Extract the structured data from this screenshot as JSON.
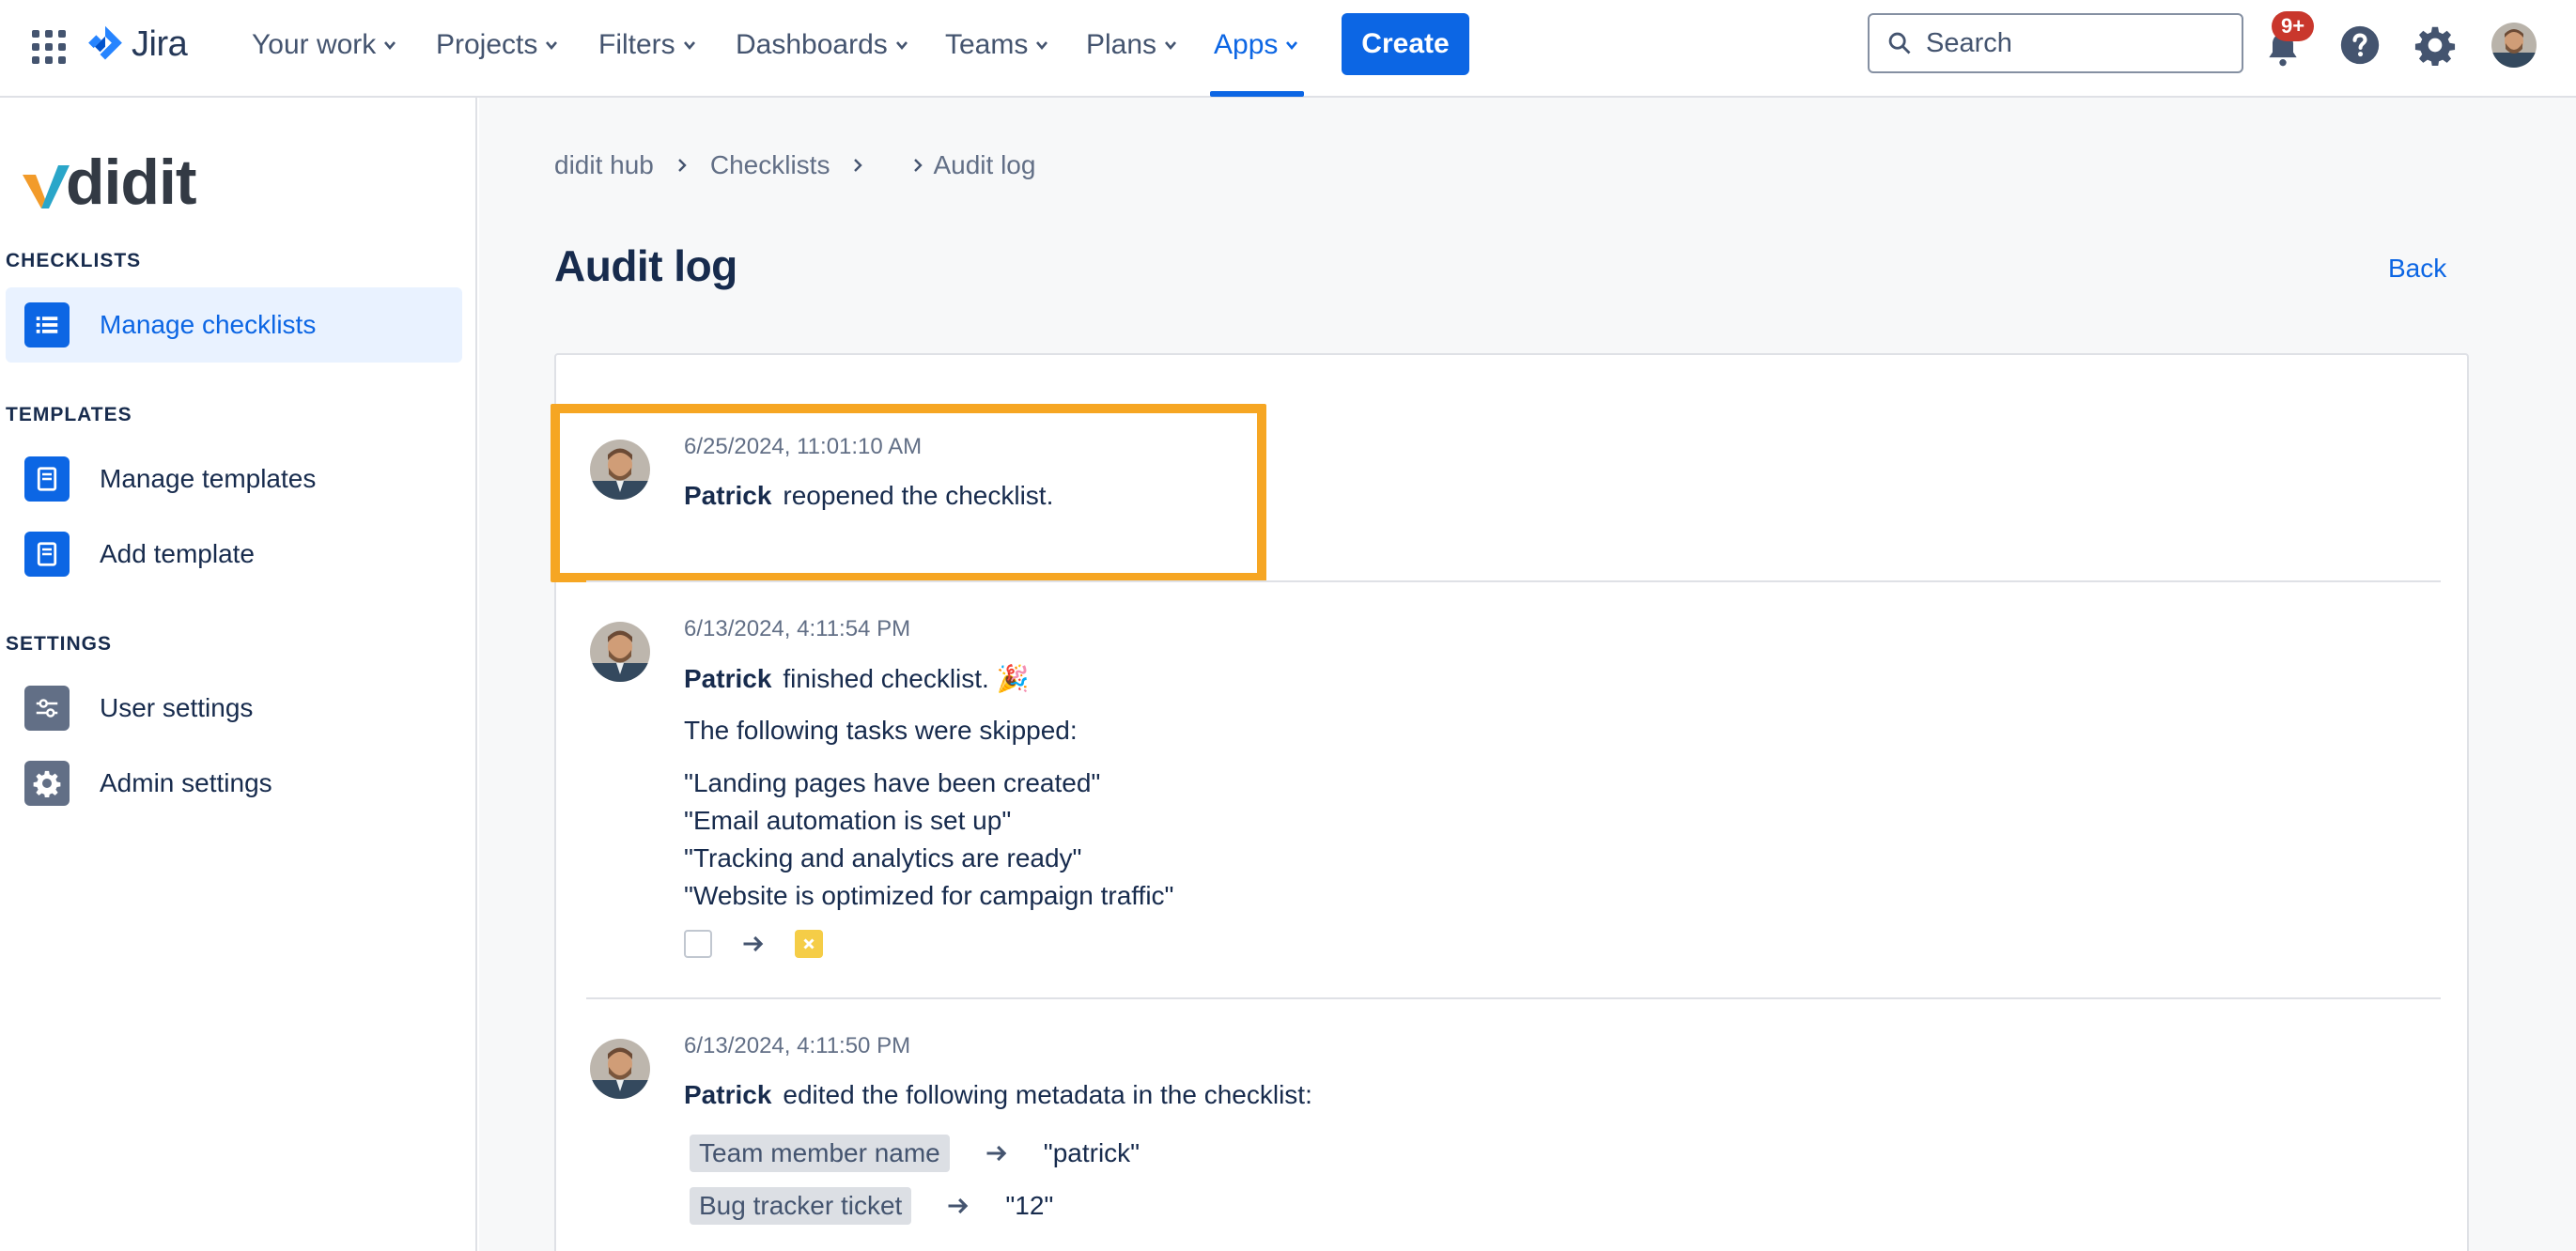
{
  "topnav": {
    "product": "Jira",
    "items": [
      {
        "label": "Your work"
      },
      {
        "label": "Projects"
      },
      {
        "label": "Filters"
      },
      {
        "label": "Dashboards"
      },
      {
        "label": "Teams"
      },
      {
        "label": "Plans"
      },
      {
        "label": "Apps",
        "active": true
      }
    ],
    "create_label": "Create",
    "search_placeholder": "Search",
    "notification_badge": "9+",
    "accent_color": "#0c66e4"
  },
  "sidebar": {
    "brand": "didit",
    "sections": [
      {
        "title": "CHECKLISTS",
        "items": [
          {
            "label": "Manage checklists",
            "icon": "list-icon",
            "active": true
          }
        ]
      },
      {
        "title": "TEMPLATES",
        "items": [
          {
            "label": "Manage templates",
            "icon": "document-icon"
          },
          {
            "label": "Add template",
            "icon": "document-icon"
          }
        ]
      },
      {
        "title": "SETTINGS",
        "items": [
          {
            "label": "User settings",
            "icon": "sliders-icon"
          },
          {
            "label": "Admin settings",
            "icon": "gear-icon"
          }
        ]
      }
    ]
  },
  "main": {
    "breadcrumb": [
      "didit hub",
      "Checklists",
      "Audit log"
    ],
    "title": "Audit log",
    "back_label": "Back",
    "highlight_color": "#f6a623",
    "entries": [
      {
        "timestamp": "6/25/2024, 11:01:10 AM",
        "user": "Patrick",
        "action": "reopened the checklist."
      },
      {
        "timestamp": "6/13/2024, 4:11:54 PM",
        "user": "Patrick",
        "action": "finished checklist. 🎉",
        "detail": "The following tasks were skipped:",
        "tasks": [
          "\"Landing pages have been created\"",
          "\"Email automation is set up\"",
          "\"Tracking and analytics are ready\"",
          "\"Website is optimized for campaign traffic\""
        ],
        "state_change": {
          "from": "unchecked",
          "to": "skipped"
        }
      },
      {
        "timestamp": "6/13/2024, 4:11:50 PM",
        "user": "Patrick",
        "action": "edited the following metadata in the checklist:",
        "metadata": [
          {
            "field": "Team member name",
            "value": "\"patrick\""
          },
          {
            "field": "Bug tracker ticket",
            "value": "\"12\""
          }
        ]
      }
    ]
  }
}
